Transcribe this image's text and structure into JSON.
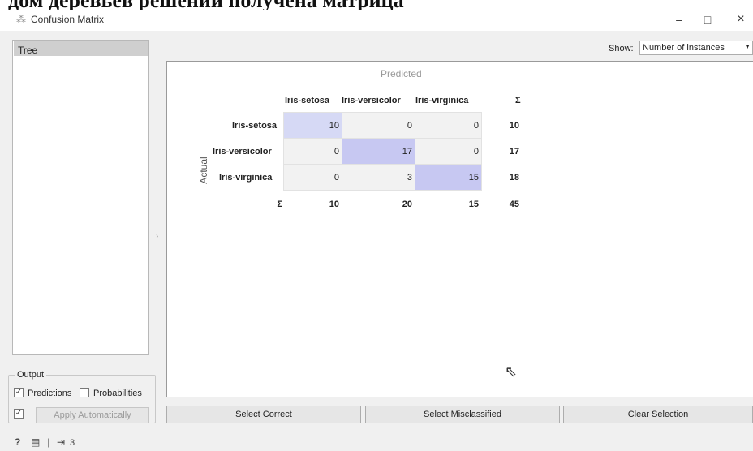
{
  "doc_text": "дом деревьев решений получена матрица",
  "window": {
    "title": "Confusion Matrix",
    "minimize": "–",
    "maximize": "□",
    "close": "×"
  },
  "learners": {
    "items": [
      "Tree"
    ]
  },
  "output": {
    "legend": "Output",
    "predictions_label": "Predictions",
    "predictions_checked": true,
    "probabilities_label": "Probabilities",
    "probabilities_checked": false,
    "apply_checked": true,
    "apply_label": "Apply Automatically"
  },
  "show": {
    "label": "Show:",
    "value": "Number of instances"
  },
  "matrix": {
    "predicted_label": "Predicted",
    "actual_label": "Actual",
    "sum_symbol": "Σ",
    "columns": [
      "Iris-setosa",
      "Iris-versicolor",
      "Iris-virginica"
    ],
    "rows": [
      {
        "label": "Iris-setosa",
        "values": [
          "10",
          "0",
          "0"
        ],
        "sum": "10"
      },
      {
        "label": "Iris-versicolor",
        "values": [
          "0",
          "17",
          "0"
        ],
        "sum": "17"
      },
      {
        "label": "Iris-virginica",
        "values": [
          "0",
          "3",
          "15"
        ],
        "sum": "18"
      }
    ],
    "col_sums": [
      "10",
      "20",
      "15"
    ],
    "total": "45"
  },
  "buttons": {
    "select_correct": "Select Correct",
    "select_misclassified": "Select Misclassified",
    "clear_selection": "Clear Selection"
  },
  "statusbar": {
    "help_icon": "?",
    "report_icon": "report",
    "output_count": "3"
  }
}
